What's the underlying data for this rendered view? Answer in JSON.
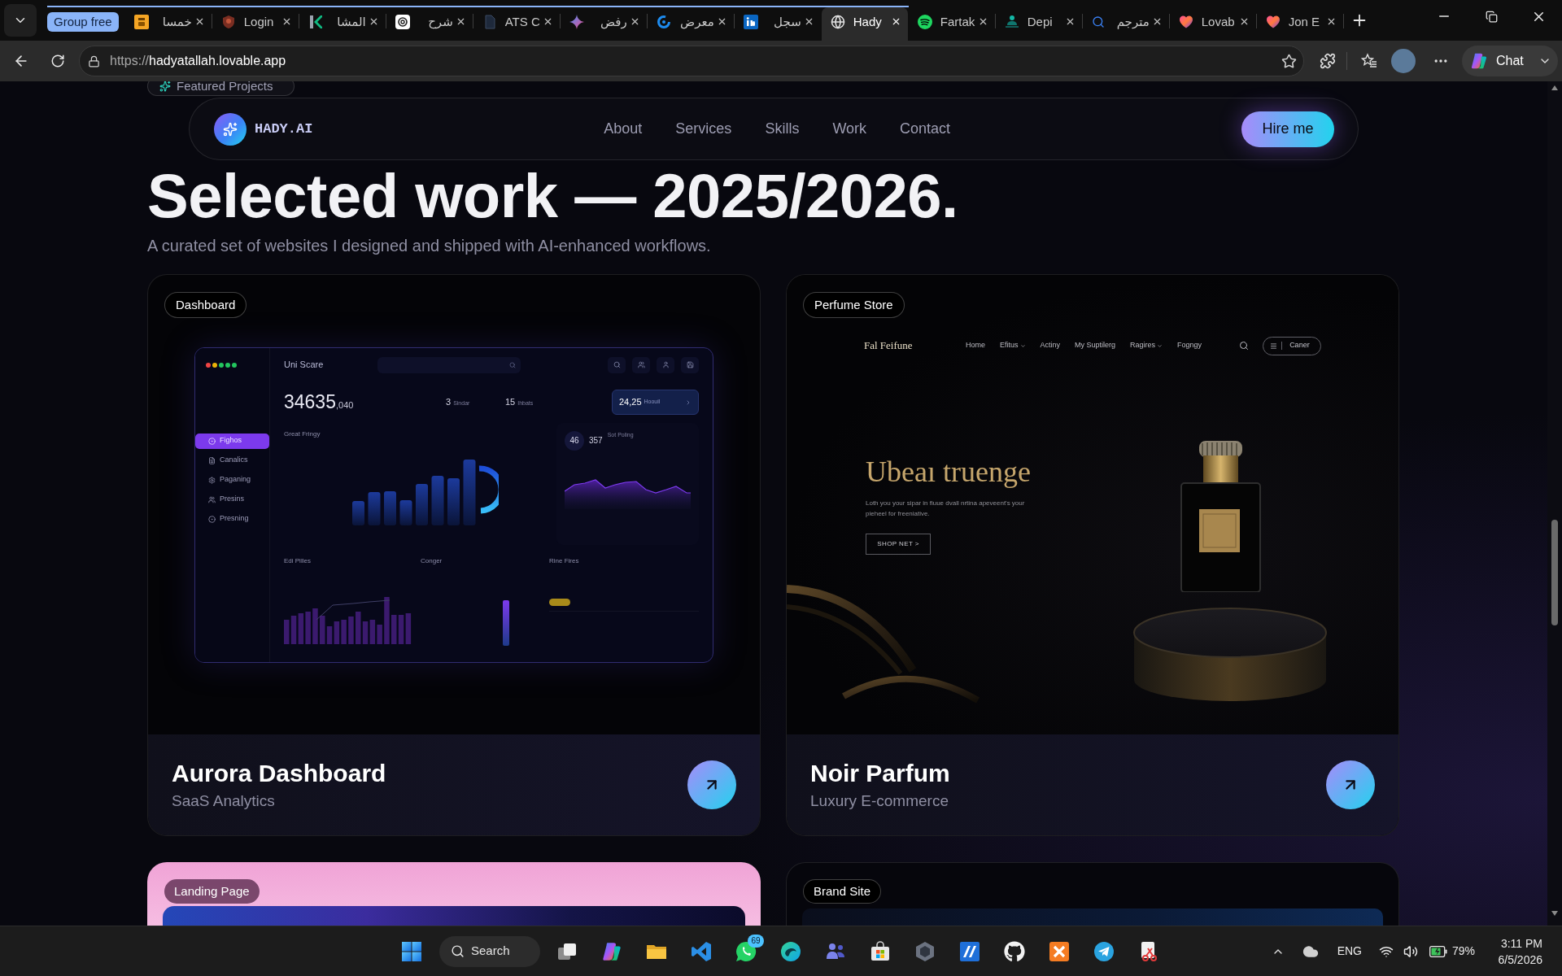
{
  "browser": {
    "tab_strip": [
      {
        "kind": "group_label",
        "label": "Group free"
      },
      {
        "kind": "tab",
        "title": "خمسا",
        "grouped": true,
        "selected": false
      },
      {
        "kind": "tab",
        "title": "Login",
        "grouped": true,
        "selected": false
      },
      {
        "kind": "tab",
        "title": "المشا",
        "grouped": true,
        "selected": false
      },
      {
        "kind": "tab",
        "title": "شرح",
        "grouped": true,
        "selected": false
      },
      {
        "kind": "tab",
        "title": "ATS C",
        "grouped": true,
        "selected": false
      },
      {
        "kind": "tab",
        "title": "رفض",
        "grouped": true,
        "selected": false
      },
      {
        "kind": "tab",
        "title": "معرض",
        "grouped": true,
        "selected": false
      },
      {
        "kind": "tab",
        "title": "سجل",
        "grouped": true,
        "selected": false
      },
      {
        "kind": "tab",
        "title": "Hady",
        "grouped": true,
        "selected": true
      },
      {
        "kind": "tab",
        "title": "Fartak",
        "grouped": false,
        "selected": false
      },
      {
        "kind": "tab",
        "title": "Depi",
        "grouped": false,
        "selected": false
      },
      {
        "kind": "tab",
        "title": "مترجم",
        "grouped": false,
        "selected": false
      },
      {
        "kind": "tab",
        "title": "Lovab",
        "grouped": false,
        "selected": false
      },
      {
        "kind": "tab",
        "title": "Jon E",
        "grouped": false,
        "selected": false
      }
    ],
    "address_bar": {
      "scheme": "https://",
      "host": "hadyatallah.lovable.app"
    },
    "chat_button": {
      "label": "Chat"
    }
  },
  "page": {
    "section_badge": "Featured Projects",
    "heading": "Selected work — 2025/2026.",
    "subheading": "A curated set of websites I designed and shipped with AI-enhanced workflows.",
    "nav": {
      "logo": "HADY.AI",
      "links": [
        "About",
        "Services",
        "Skills",
        "Work",
        "Contact"
      ],
      "cta": "Hire me"
    },
    "projects": [
      {
        "category": "Dashboard",
        "title": "Aurora Dashboard",
        "subtitle": "SaaS Analytics",
        "preview": {
          "kind": "dashboard",
          "app_name": "Uni Scare",
          "menu": [
            {
              "label": "Fighos",
              "selected": true
            },
            {
              "label": "Canalics",
              "selected": false
            },
            {
              "label": "Paganing",
              "selected": false
            },
            {
              "label": "Presins",
              "selected": false
            },
            {
              "label": "Presning",
              "selected": false
            }
          ],
          "total": "34635",
          "total_fraction": ",040",
          "stats": [
            {
              "value": "3",
              "label": "Sindar"
            },
            {
              "value": "15",
              "label": "Ihbats"
            }
          ],
          "highlight": {
            "value": "24,25",
            "label": "Hoouil"
          },
          "chart_title": "Great Fringy",
          "score": "46",
          "score_total": "357",
          "score_label": "Sot Poling",
          "panels": [
            "Edi Pilles",
            "Conger",
            "Rine Fires"
          ]
        }
      },
      {
        "category": "Perfume Store",
        "title": "Noir Parfum",
        "subtitle": "Luxury E-commerce",
        "preview": {
          "kind": "storefront",
          "brand": "Fal Feifune",
          "menu": [
            {
              "label": "Home",
              "dropdown": false
            },
            {
              "label": "Efitus",
              "dropdown": true
            },
            {
              "label": "Actiny",
              "dropdown": false
            },
            {
              "label": "My Suptilerg",
              "dropdown": false
            },
            {
              "label": "Ragires",
              "dropdown": true
            },
            {
              "label": "Fogngy",
              "dropdown": false
            }
          ],
          "account": "Caner",
          "headline": "Ubeaı truenge",
          "body": "Loth you your sipar in fiuue dvall nrtina apeveent's your pieheel for freeniative.",
          "cta": "SHOP NET >"
        }
      },
      {
        "category": "Landing Page",
        "preview": {
          "kind": "landing"
        }
      },
      {
        "category": "Brand Site",
        "preview": {
          "kind": "brand"
        }
      }
    ]
  },
  "taskbar": {
    "search": "Search",
    "badge": "69"
  },
  "system_tray": {
    "language": "ENG",
    "battery": "79%",
    "time": "3:11 PM",
    "date": "6/5/2026"
  }
}
